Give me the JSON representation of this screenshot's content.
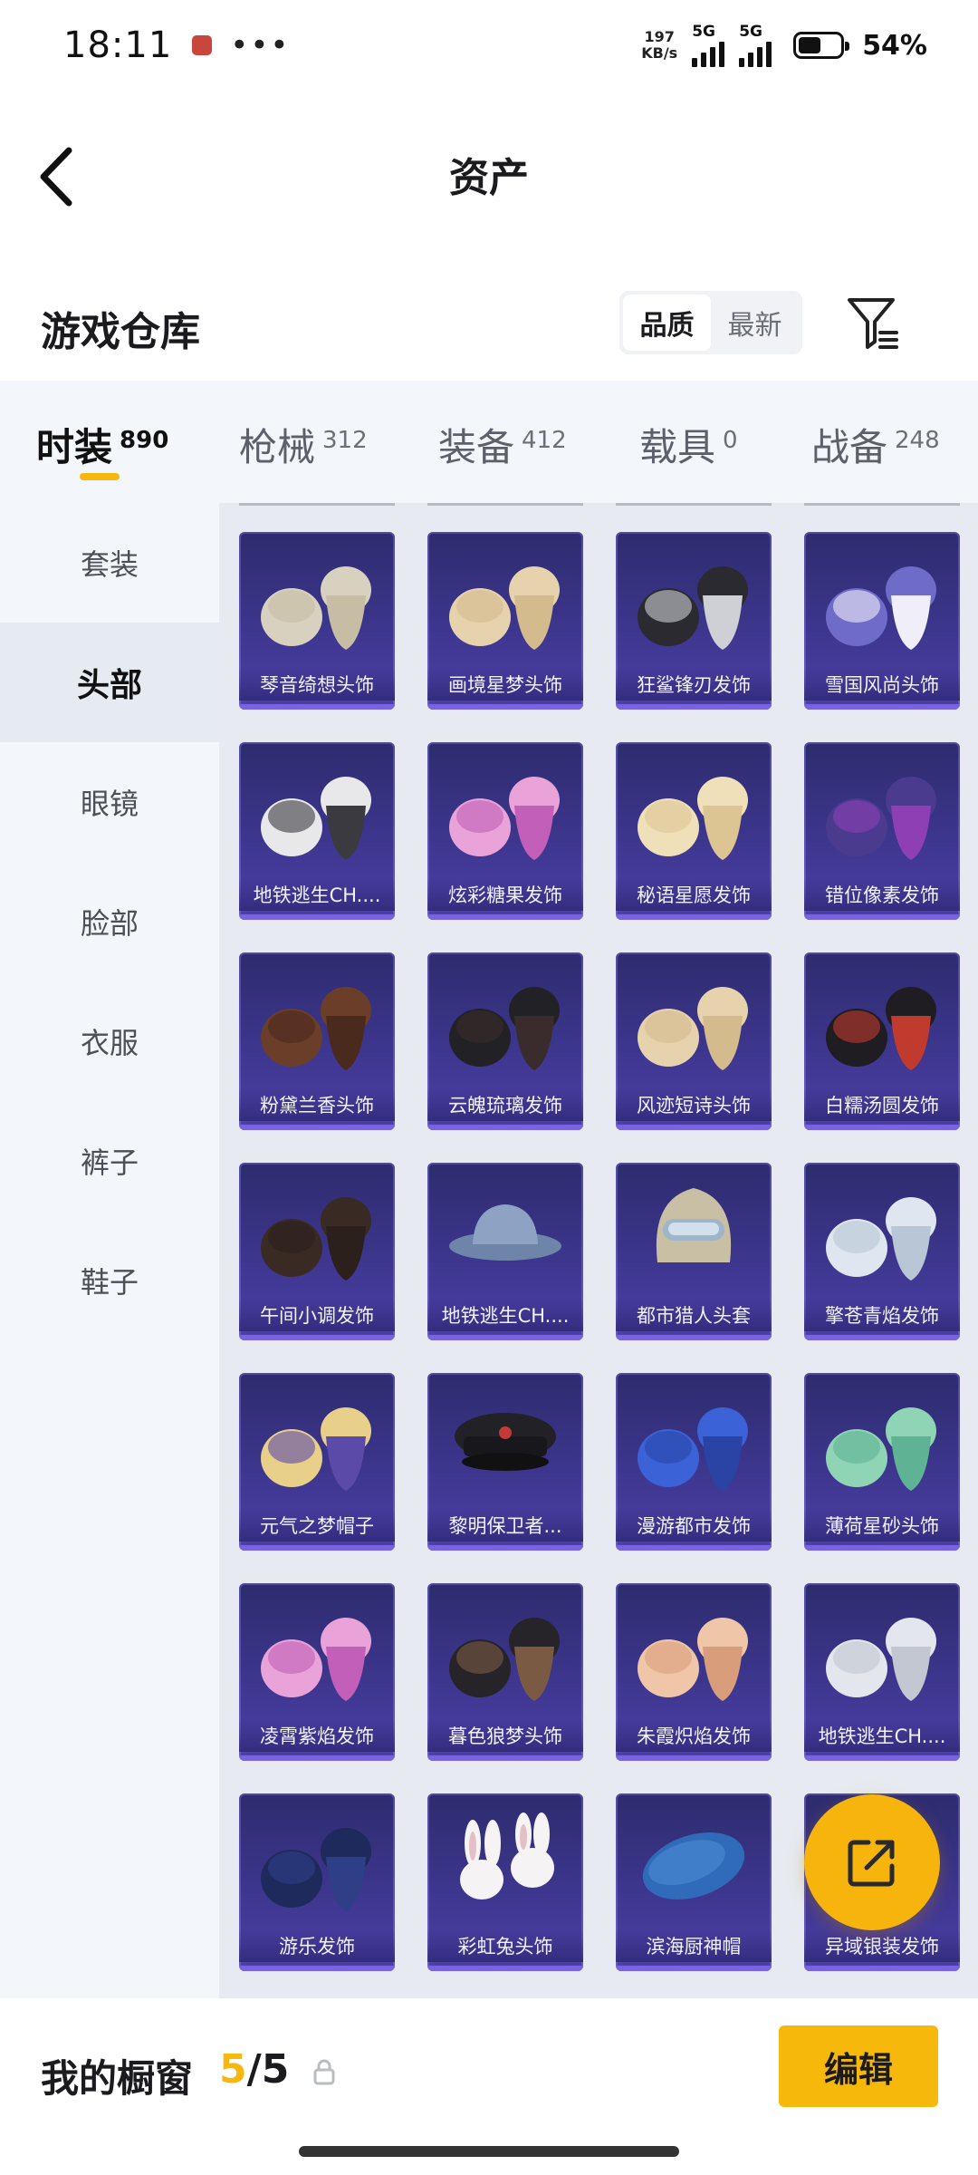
{
  "status_bar": {
    "time": "18:11",
    "net_speed_value": "197",
    "net_speed_unit": "KB/s",
    "signal_1": "5G",
    "signal_2": "5G",
    "battery": "54%",
    "battery_level": 0.54
  },
  "header": {
    "title": "资产"
  },
  "section": {
    "title": "游戏仓库",
    "sort_options": [
      "品质",
      "最新"
    ],
    "sort_selected": "品质"
  },
  "tabs": [
    {
      "label": "时装",
      "count": "890",
      "active": true
    },
    {
      "label": "枪械",
      "count": "312",
      "active": false
    },
    {
      "label": "装备",
      "count": "412",
      "active": false
    },
    {
      "label": "载具",
      "count": "0",
      "active": false
    },
    {
      "label": "战备",
      "count": "248",
      "active": false
    }
  ],
  "sidebar": {
    "items": [
      {
        "label": "套装",
        "active": false
      },
      {
        "label": "头部",
        "active": true
      },
      {
        "label": "眼镜",
        "active": false
      },
      {
        "label": "脸部",
        "active": false
      },
      {
        "label": "衣服",
        "active": false
      },
      {
        "label": "裤子",
        "active": false
      },
      {
        "label": "鞋子",
        "active": false
      }
    ]
  },
  "items": [
    {
      "name": "琴音绮想头饰",
      "icon": "hair-cream-icon"
    },
    {
      "name": "画境星梦头饰",
      "icon": "hair-blonde-long-icon"
    },
    {
      "name": "狂鲨锋刃发饰",
      "icon": "hair-black-white-icon"
    },
    {
      "name": "雪国风尚头饰",
      "icon": "hair-lavender-earmuff-icon"
    },
    {
      "name": "地铁逃生CH....",
      "icon": "beanie-stripe-icon"
    },
    {
      "name": "炫彩糖果发饰",
      "icon": "hair-pink-twin-icon"
    },
    {
      "name": "秘语星愿发饰",
      "icon": "hair-blonde-twin-icon"
    },
    {
      "name": "错位像素发饰",
      "icon": "hair-purple-icon"
    },
    {
      "name": "粉黛兰香头饰",
      "icon": "hair-brown-icon"
    },
    {
      "name": "云魄琉璃发饰",
      "icon": "hair-black-long-icon"
    },
    {
      "name": "风迹短诗头饰",
      "icon": "hair-blonde-long-icon"
    },
    {
      "name": "白糯汤圆发饰",
      "icon": "hair-black-bun-icon"
    },
    {
      "name": "午间小调发饰",
      "icon": "hair-dark-brown-icon"
    },
    {
      "name": "地铁逃生CH....",
      "icon": "bucket-hat-icon"
    },
    {
      "name": "都市猎人头套",
      "icon": "mask-fur-icon"
    },
    {
      "name": "擎苍青焰发饰",
      "icon": "hair-white-spiky-icon"
    },
    {
      "name": "元气之梦帽子",
      "icon": "hair-cap-blonde-icon"
    },
    {
      "name": "黎明保卫者...",
      "icon": "police-cap-icon"
    },
    {
      "name": "漫游都市发饰",
      "icon": "hair-blue-icon"
    },
    {
      "name": "薄荷星砂头饰",
      "icon": "hair-mint-icon"
    },
    {
      "name": "凌霄紫焰发饰",
      "icon": "hair-pink-twin-icon"
    },
    {
      "name": "暮色狼梦头饰",
      "icon": "hair-wolf-ear-icon"
    },
    {
      "name": "朱霞炽焰发饰",
      "icon": "hair-peach-icon"
    },
    {
      "name": "地铁逃生CH....",
      "icon": "hair-silver-icon"
    },
    {
      "name": "游乐发饰",
      "icon": "hair-navy-icon"
    },
    {
      "name": "彩虹兔头饰",
      "icon": "bunny-ear-icon"
    },
    {
      "name": "滨海厨神帽",
      "icon": "chef-hat-icon"
    },
    {
      "name": "异域银装发饰",
      "icon": "hair-silver-icon"
    }
  ],
  "bottom_bar": {
    "showcase_label": "我的橱窗",
    "current": "5",
    "separator": "/",
    "max": "5",
    "edit_label": "编辑"
  },
  "colors": {
    "accent": "#f6b70f",
    "card_top": "#2d2c6e",
    "card_bottom": "#4c40a8"
  }
}
